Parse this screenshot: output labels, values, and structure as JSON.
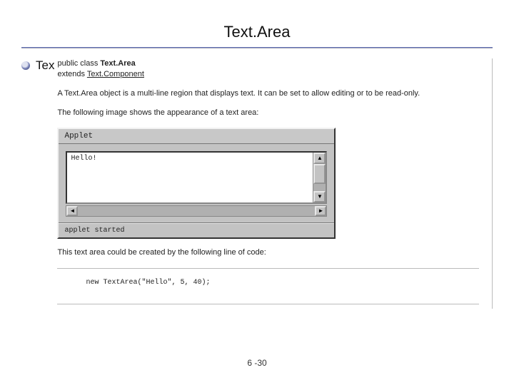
{
  "title": "Text.Area",
  "lead_text": "Tex",
  "decl": {
    "line1_prefix": "public class ",
    "classname": "Text.Area",
    "line2_prefix": "extends ",
    "superclass": "Text.Component"
  },
  "desc_para": "A Text.Area object is a multi-line region that displays text. It can be set to allow editing or to be read-only.",
  "appearance_para": "The following image shows the appearance of a text area:",
  "applet": {
    "title": "Applet",
    "textarea_content": "Hello!",
    "status": "applet started"
  },
  "closing_para": "This text area could be created by the following line of code:",
  "code_line": "new TextArea(\"Hello\", 5, 40);",
  "page_number": "6 -30"
}
